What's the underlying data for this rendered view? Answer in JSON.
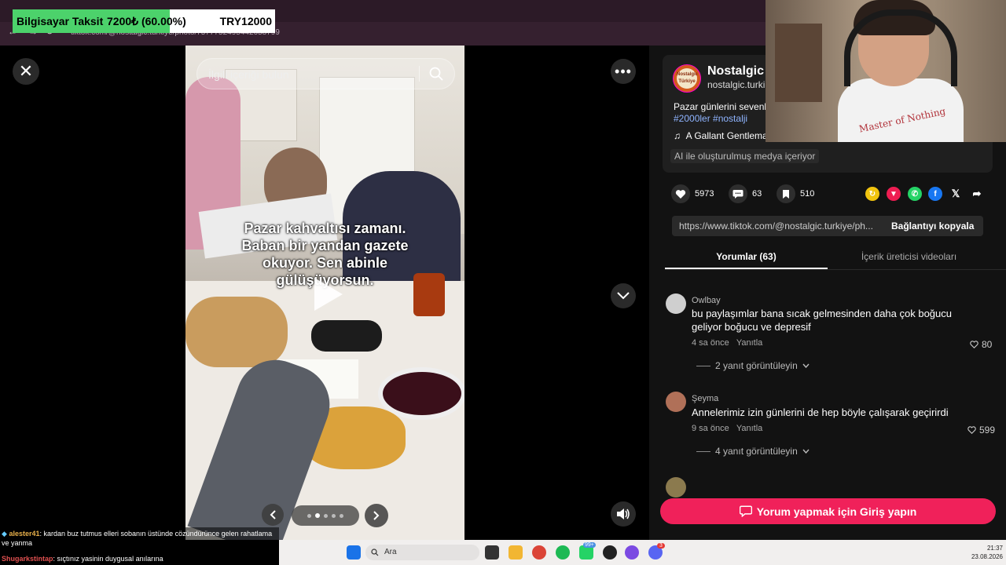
{
  "browser": {
    "url": "tiktok.com/@nostalgic.turkiye/photo/7577752495442658799"
  },
  "taksit": {
    "label": "Bilgisayar Taksit",
    "progress": "7200₺ (60.00%)",
    "progress_fraction": 0.6,
    "target": "TRY12000"
  },
  "viewer": {
    "search_placeholder": "İlgili içeriği bulun",
    "caption": "Pazar kahvaltısı zamanı.\nBaban bir yandan gazete\nokuyor. Sen abinle\ngülüşüyorsun.",
    "carousel_dots": 5,
    "carousel_active": 1
  },
  "post": {
    "author_name": "Nostalgic T",
    "author_handle": "nostalgic.turki",
    "avatar_text": "Nostalgic Türkiye",
    "description": "Pazar günlerini sevenle",
    "tags": "#2000ler #nostalji",
    "music": "A Gallant Gentlema",
    "ai_label": "AI ile oluşturulmuş medya içeriyor",
    "likes": "5973",
    "comments": "63",
    "saves": "510",
    "link": "https://www.tiktok.com/@nostalgic.turkiye/ph...",
    "copy_link_label": "Bağlantıyı kopyala"
  },
  "tabs": {
    "comments": "Yorumlar (63)",
    "creator_videos": "İçerik üreticisi videoları"
  },
  "comments": [
    {
      "user": "Owlbay",
      "text": "bu paylaşımlar bana sıcak gelmesinden daha çok boğucu geliyor boğucu ve depresif",
      "time": "4 sa önce",
      "reply_label": "Yanıtla",
      "likes": "80",
      "view_replies": "2 yanıt görüntüleyin"
    },
    {
      "user": "Şeyma",
      "text": "Annelerimiz izin günlerini de hep böyle çalışarak geçirirdi",
      "time": "9 sa önce",
      "reply_label": "Yanıtla",
      "likes": "599",
      "view_replies": "4 yanıt görüntüleyin"
    }
  ],
  "login_button": "Yorum yapmak için Giriş yapın",
  "webcam": {
    "shirt_text": "Master of Nothing"
  },
  "chat": [
    {
      "user": "alester41",
      "message": ": kardan buz tutmus elleri sobanın üstünde cözündürünce gelen rahatlama ve yanma"
    },
    {
      "user": "Shugarkstintap",
      "message": ": sıçtınız yasinin duygusal anılarına"
    }
  ],
  "taskbar": {
    "search_placeholder": "Ara",
    "time": "21:37",
    "date": "23.08.2026",
    "badge_whatsapp": "99+",
    "badge_discord": "3"
  },
  "colors": {
    "accent": "#f0215a",
    "panel_bg": "#121212",
    "hashtag": "#8fb4ff"
  }
}
